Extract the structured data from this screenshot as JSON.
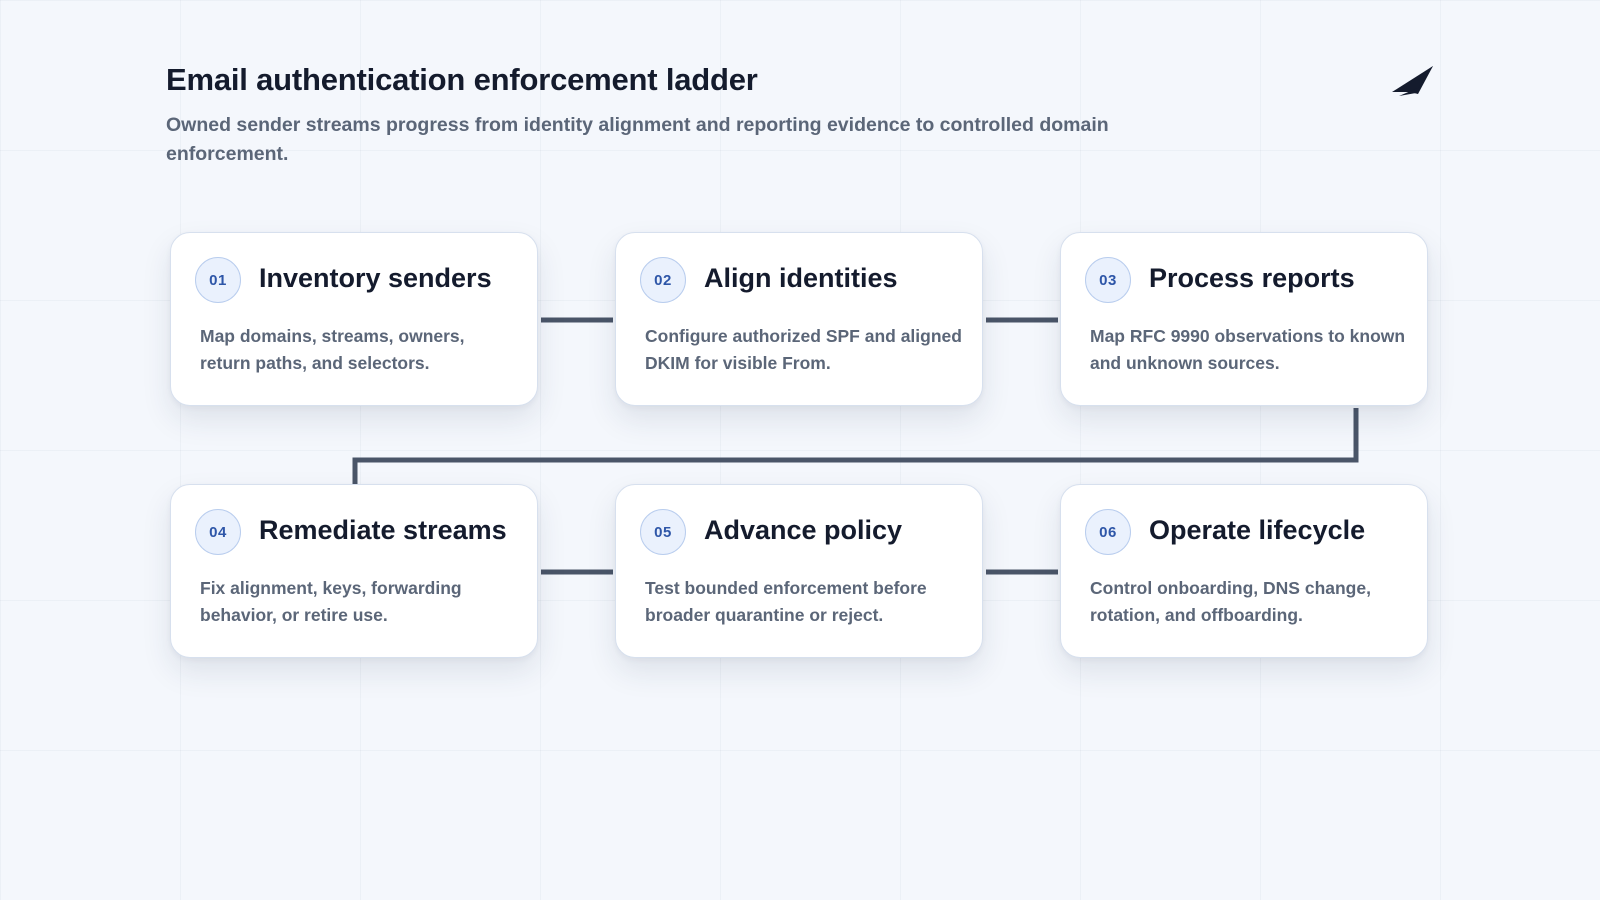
{
  "header": {
    "title": "Email authentication enforcement ladder",
    "subtitle": "Owned sender streams progress from identity alignment and reporting evidence to controlled domain enforcement."
  },
  "logo": {
    "icon": "paper-plane-icon",
    "color": "#141b2d"
  },
  "colors": {
    "connector": "#4a5568",
    "badge_text": "#2e56a8",
    "badge_fill": "#eaf1fd",
    "title_text": "#141b2d",
    "body_text": "#5b6678"
  },
  "steps": [
    {
      "number": "01",
      "title": "Inventory senders",
      "description": "Map domains, streams, owners, return paths, and selectors."
    },
    {
      "number": "02",
      "title": "Align identities",
      "description": "Configure authorized SPF and aligned DKIM for visible From."
    },
    {
      "number": "03",
      "title": "Process reports",
      "description": "Map RFC 9990 observations to known and unknown sources."
    },
    {
      "number": "04",
      "title": "Remediate streams",
      "description": "Fix alignment, keys, forwarding behavior, or retire use."
    },
    {
      "number": "05",
      "title": "Advance policy",
      "description": "Test bounded enforcement before broader quarantine or reject."
    },
    {
      "number": "06",
      "title": "Operate lifecycle",
      "description": "Control onboarding, DNS change, rotation, and offboarding."
    }
  ]
}
